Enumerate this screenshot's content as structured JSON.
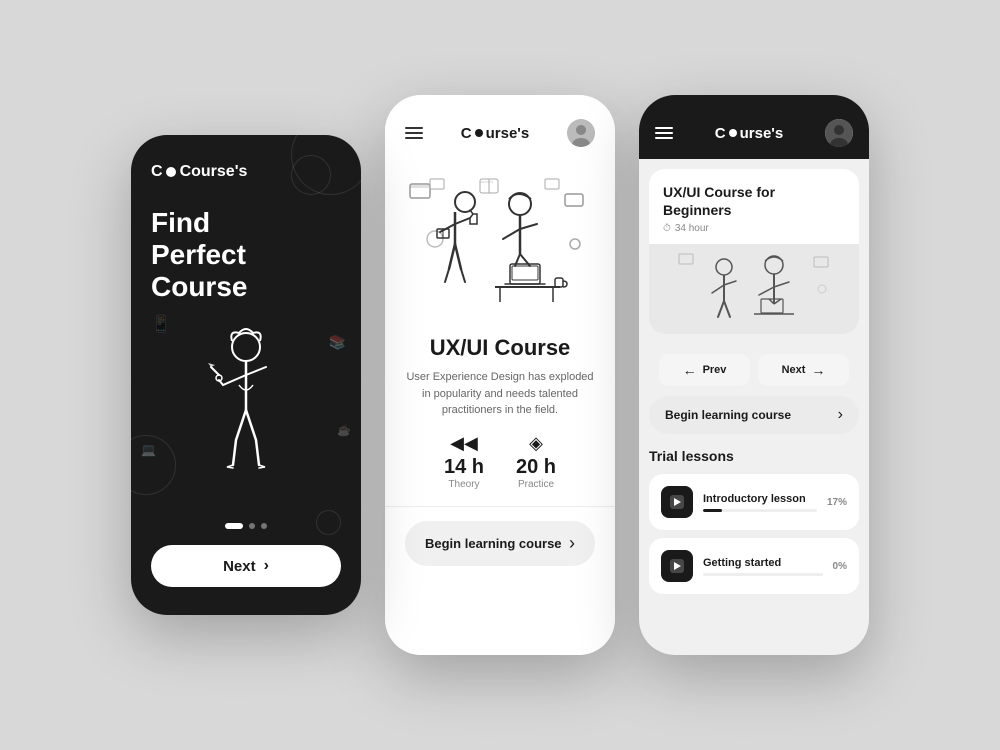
{
  "app": {
    "name": "Course's",
    "logo_symbol": "●"
  },
  "screen1": {
    "title_line1": "Find",
    "title_line2": "Perfect Course",
    "next_label": "Next",
    "dots": [
      {
        "active": true
      },
      {
        "active": false
      },
      {
        "active": false
      }
    ]
  },
  "screen2": {
    "course_title": "UX/UI Course",
    "course_desc": "User Experience Design has exploded in popularity and needs talented practitioners in the field.",
    "stats": [
      {
        "value": "14 h",
        "label": "Theory",
        "icon": "◀"
      },
      {
        "value": "20 h",
        "label": "Practice",
        "icon": "◈"
      }
    ],
    "begin_label": "Begin learning course",
    "begin_arrow": "›"
  },
  "screen3": {
    "course_card": {
      "title": "UX/UI Course for Beginners",
      "time": "34 hour"
    },
    "prev_label": "Prev",
    "next_label": "Next",
    "begin_label": "Begin learning course",
    "begin_arrow": "›",
    "trial_title": "Trial lessons",
    "lessons": [
      {
        "name": "Introductory lesson",
        "progress": 17,
        "progress_label": "17%"
      },
      {
        "name": "Getting started",
        "progress": 0,
        "progress_label": "0%"
      }
    ]
  },
  "icons": {
    "hamburger": "≡",
    "arrow_right": "›",
    "arrow_left": "‹",
    "clock": "⏱",
    "play": "▶",
    "bookmark": "🔖"
  }
}
